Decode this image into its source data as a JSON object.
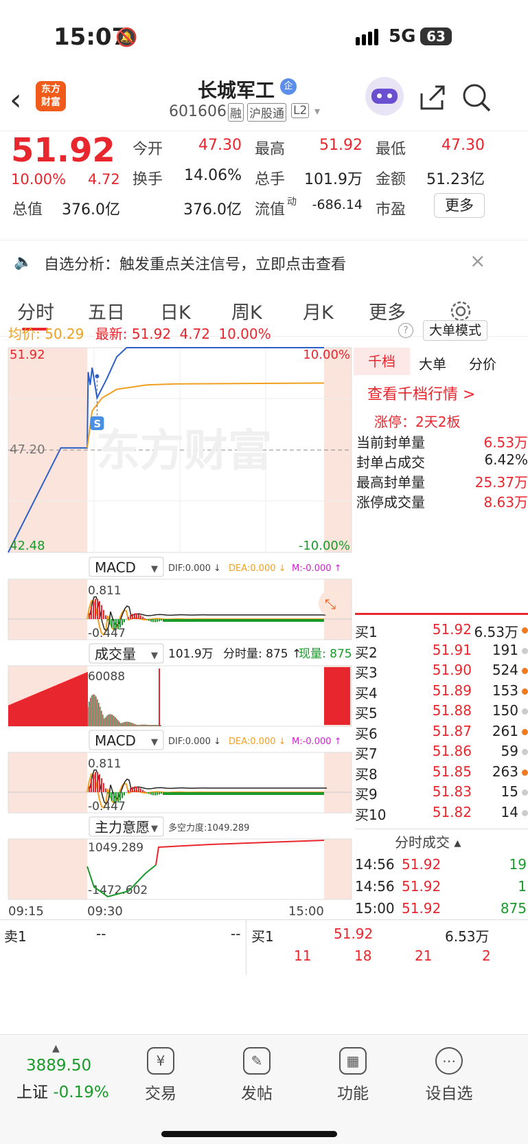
{
  "status": {
    "time": "15:07",
    "network": "5G",
    "battery": "63"
  },
  "header": {
    "title": "长城军工",
    "title_badge": "企",
    "code": "601606",
    "tags": [
      "融",
      "沪股通",
      "L2"
    ],
    "logo_line1": "东方",
    "logo_line2": "财富"
  },
  "quote": {
    "price": "51.92",
    "pct": "10.00%",
    "chg": "4.72",
    "fields": [
      {
        "label": "今开",
        "value": "47.30",
        "color": "red"
      },
      {
        "label": "最高",
        "value": "51.92",
        "color": "red"
      },
      {
        "label": "最低",
        "value": "47.30",
        "color": "red"
      },
      {
        "label": "换手",
        "value": "14.06%",
        "color": "black"
      },
      {
        "label": "总手",
        "value": "101.9万",
        "color": "black"
      },
      {
        "label": "金额",
        "value": "51.23亿",
        "color": "black"
      },
      {
        "label": "总值",
        "value": "376.0亿",
        "color": "black"
      },
      {
        "label": "流值",
        "value": "376.0亿",
        "color": "black"
      },
      {
        "label": "市盈",
        "value": "-686.14",
        "color": "black",
        "sup": "动"
      }
    ],
    "more_button": "更多"
  },
  "notice": {
    "text": "自选分析：触发重点关注信号，立即点击查看"
  },
  "tabs": [
    "分时",
    "五日",
    "日K",
    "周K",
    "月K",
    "更多"
  ],
  "info": {
    "avg_label": "均价:",
    "avg": "50.29",
    "latest_label": "最新:",
    "latest": "51.92",
    "chg": "4.72",
    "pct": "10.00%",
    "mode_button": "大单模式"
  },
  "chart_data": [
    {
      "type": "line",
      "title": "分时",
      "y_labels": {
        "top": "51.92",
        "mid": "47.20",
        "bottom": "42.48",
        "top_pct": "10.00%",
        "bottom_pct": "-10.00%"
      },
      "x_labels": [
        "09:15",
        "09:30",
        "15:00"
      ],
      "watermark": "东方财富",
      "marker": "S",
      "series": [
        {
          "name": "价格",
          "color": "#2d5fc8",
          "x": [
            "09:15",
            "09:25",
            "09:30",
            "09:31",
            "09:33",
            "09:35",
            "09:40",
            "09:50",
            "10:00",
            "10:10",
            "10:30",
            "15:00"
          ],
          "values": [
            42.48,
            47.3,
            47.3,
            50.8,
            50.2,
            51.0,
            49.6,
            50.5,
            51.5,
            51.92,
            51.92,
            51.92
          ]
        },
        {
          "name": "均价",
          "color": "#f0a020",
          "x": [
            "09:30",
            "09:35",
            "09:45",
            "10:00",
            "10:30",
            "11:00",
            "15:00"
          ],
          "values": [
            47.3,
            49.0,
            49.6,
            50.0,
            50.2,
            50.25,
            50.29
          ]
        }
      ]
    },
    {
      "type": "line",
      "title": "MACD",
      "y_range": [
        "0.811",
        "-0.447"
      ],
      "legend": [
        "DIF:0.000 ↓",
        "DEA:0.000 ↓",
        "M:-0.000 ↑"
      ]
    },
    {
      "type": "bar",
      "title": "成交量",
      "y_max": "60088",
      "legend": [
        "101.9万",
        "分时量: 875 ↑",
        "现量: 875"
      ]
    },
    {
      "type": "line",
      "title": "MACD",
      "y_range": [
        "0.811",
        "-0.447"
      ],
      "legend": [
        "DIF:0.000 ↓",
        "DEA:0.000 ↓",
        "M:-0.000 ↑"
      ]
    },
    {
      "type": "line",
      "title": "主力意愿",
      "y_range": [
        "1049.289",
        "-1472.602"
      ],
      "legend": [
        "多空力度:1049.289"
      ]
    }
  ],
  "right": {
    "tabs": [
      "千档",
      "大单",
      "分价"
    ],
    "link": "查看千档行情 >",
    "limit": "涨停：2天2板",
    "stats": [
      {
        "label": "当前封单量",
        "value": "6.53万"
      },
      {
        "label": "封单占成交",
        "value": "6.42%"
      },
      {
        "label": "最高封单量",
        "value": "25.37万"
      },
      {
        "label": "涨停成交量",
        "value": "8.63万"
      }
    ],
    "bids": [
      {
        "label": "买1",
        "price": "51.92",
        "vol": "6.53万",
        "dot": "#f07a20"
      },
      {
        "label": "买2",
        "price": "51.91",
        "vol": "191",
        "dot": "#ccc"
      },
      {
        "label": "买3",
        "price": "51.90",
        "vol": "524",
        "dot": "#f07a20"
      },
      {
        "label": "买4",
        "price": "51.89",
        "vol": "153",
        "dot": "#f07a20"
      },
      {
        "label": "买5",
        "price": "51.88",
        "vol": "150",
        "dot": "#ccc"
      },
      {
        "label": "买6",
        "price": "51.87",
        "vol": "261",
        "dot": "#f07a20"
      },
      {
        "label": "买7",
        "price": "51.86",
        "vol": "59",
        "dot": "#ccc"
      },
      {
        "label": "买8",
        "price": "51.85",
        "vol": "263",
        "dot": "#f07a20"
      },
      {
        "label": "买9",
        "price": "51.83",
        "vol": "15",
        "dot": "#ccc"
      },
      {
        "label": "买10",
        "price": "51.82",
        "vol": "14",
        "dot": "#ccc"
      }
    ],
    "ticks_title": "分时成交",
    "ticks": [
      {
        "time": "14:56",
        "price": "51.92",
        "vol": "19"
      },
      {
        "time": "14:56",
        "price": "51.92",
        "vol": "1"
      },
      {
        "time": "15:00",
        "price": "51.92",
        "vol": "875"
      }
    ]
  },
  "book": {
    "sell_label": "卖1",
    "sell_price": "--",
    "sell_vol": "--",
    "buy_label": "买1",
    "buy_price": "51.92",
    "buy_vol": "6.53万",
    "queue": [
      "11",
      "18",
      "21",
      "2"
    ]
  },
  "bottom": {
    "index_value": "3889.50",
    "index_name": "上证",
    "index_pct": "-0.19%",
    "items": [
      {
        "label": "交易",
        "icon": "¥"
      },
      {
        "label": "发帖",
        "icon": "✎"
      },
      {
        "label": "功能",
        "icon": "▦"
      },
      {
        "label": "设自选",
        "icon": "⋯"
      }
    ]
  }
}
